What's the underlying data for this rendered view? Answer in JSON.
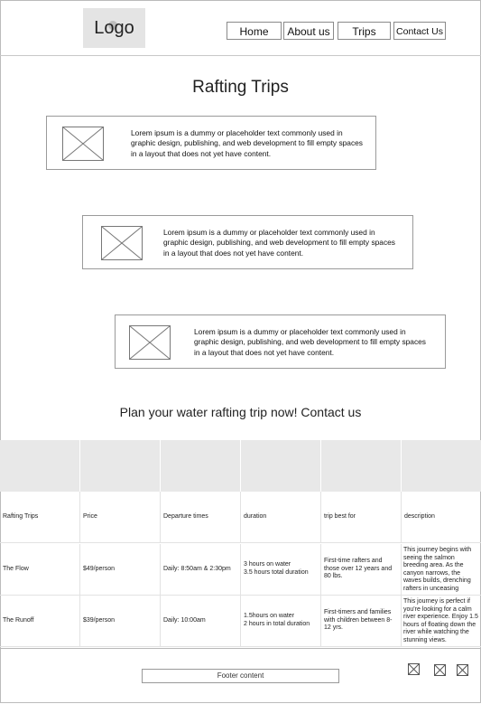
{
  "header": {
    "logo": "Logo",
    "nav": [
      "Home",
      "About us",
      "Trips",
      "Contact Us"
    ]
  },
  "main": {
    "title": "Rafting Trips",
    "cards": [
      {
        "text": "Lorem ipsum is a dummy or placeholder text commonly used in graphic design, publishing, and web development to fill empty spaces in a layout that does not yet have content."
      },
      {
        "text": "Lorem ipsum is a dummy or placeholder text commonly used in graphic design, publishing, and web development to fill empty spaces in a layout that does not yet have content."
      },
      {
        "text": "Lorem ipsum is a dummy or placeholder text commonly used in graphic design, publishing, and web development to fill empty spaces in a layout that does not yet have content."
      }
    ],
    "cta": "Plan your water rafting trip now! Contact us"
  },
  "table": {
    "columns": [
      "Rafting Trips",
      "Price",
      "Departure times",
      "duration",
      "trip best for",
      "description"
    ],
    "rows": [
      [
        "The Flow",
        "$49/person",
        "Daily: 8:50am & 2:30pm",
        "3 hours on water\n3.5 hours total duration",
        "First-time rafters and those over 12 years and 80 lbs.",
        "This journey begins with seeing the salmon breeding area. As the canyon narrows, the waves builds, drenching rafters in unceasing"
      ],
      [
        "The Runoff",
        "$39/person",
        "Daily: 10:00am",
        "1.5hours on water\n2 hours in total duration",
        "First-timers and families with children between 8-12 yrs.",
        "This journey is perfect if you're looking for a calm river experience. Enjoy 1.5 hours of floating down the river while watching the stunning views."
      ]
    ]
  },
  "footer": {
    "content": "Footer content",
    "icons": [
      "image-placeholder-icon",
      "image-placeholder-icon",
      "image-placeholder-icon"
    ]
  }
}
